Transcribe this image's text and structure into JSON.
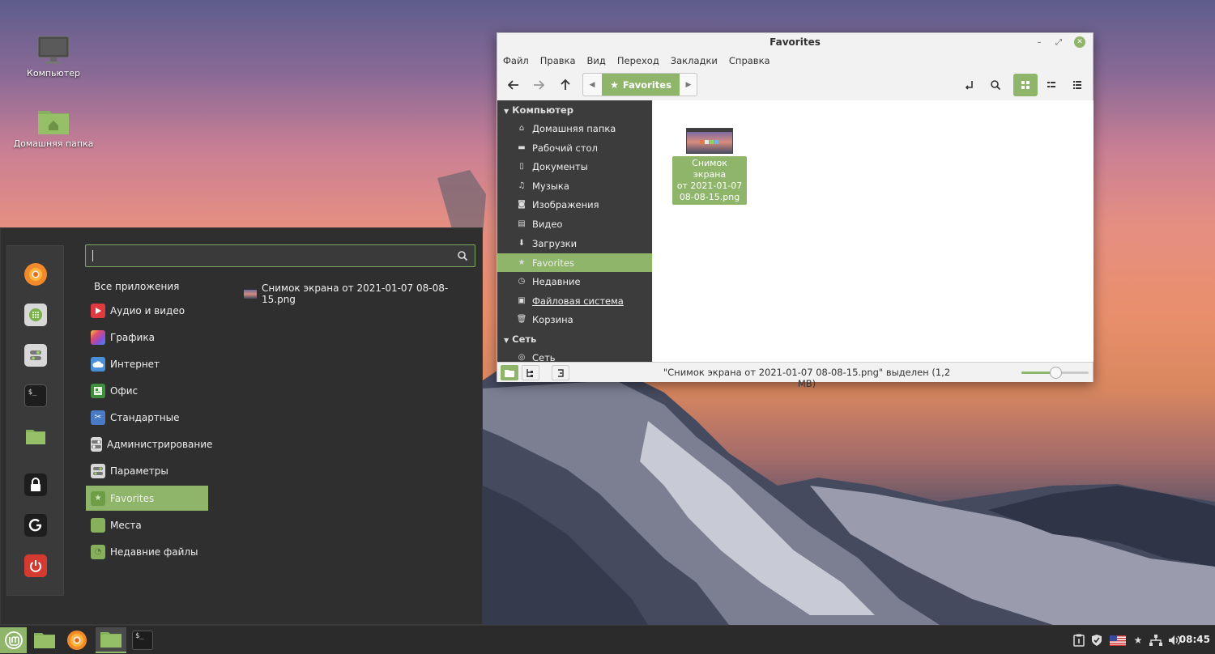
{
  "desktop": {
    "icons": [
      {
        "label": "Компьютер",
        "icon": "monitor-icon"
      },
      {
        "label": "Домашняя папка",
        "icon": "home-folder-icon"
      }
    ]
  },
  "menu": {
    "favorites": [
      "firefox-icon",
      "software-manager-icon",
      "settings-icon",
      "terminal-icon",
      "files-icon",
      "lock-icon",
      "logout-icon",
      "power-icon"
    ],
    "search": {
      "value": "",
      "placeholder": ""
    },
    "all_apps_label": "Все приложения",
    "categories": [
      {
        "label": "Аудио и видео",
        "icon": "multimedia-icon",
        "color": "#e0393e"
      },
      {
        "label": "Графика",
        "icon": "graphics-icon",
        "color": "#b84fd1"
      },
      {
        "label": "Интернет",
        "icon": "internet-icon",
        "color": "#4a90d9"
      },
      {
        "label": "Офис",
        "icon": "office-icon",
        "color": "#3f8f3f"
      },
      {
        "label": "Стандартные",
        "icon": "accessories-icon",
        "color": "#4a7cc6"
      },
      {
        "label": "Администрирование",
        "icon": "administration-icon",
        "color": "#8a8a8a"
      },
      {
        "label": "Параметры",
        "icon": "preferences-icon",
        "color": "#8a8a8a"
      },
      {
        "label": "Favorites",
        "icon": "favorites-folder-icon",
        "color": "#6d9e46"
      },
      {
        "label": "Места",
        "icon": "places-folder-icon",
        "color": "#86b05c"
      },
      {
        "label": "Недавние файлы",
        "icon": "recent-folder-icon",
        "color": "#86b05c"
      }
    ],
    "selected_category": "Favorites",
    "recent_file": "Снимок экрана от 2021-01-07 08-08-15.png"
  },
  "file_manager": {
    "title": "Favorites",
    "menubar": [
      "Файл",
      "Правка",
      "Вид",
      "Переход",
      "Закладки",
      "Справка"
    ],
    "location": "Favorites",
    "sidebar": {
      "computer_header": "Компьютер",
      "items": [
        {
          "label": "Домашняя папка",
          "icon": "home-icon"
        },
        {
          "label": "Рабочий стол",
          "icon": "desktop-icon"
        },
        {
          "label": "Документы",
          "icon": "documents-icon"
        },
        {
          "label": "Музыка",
          "icon": "music-icon"
        },
        {
          "label": "Изображения",
          "icon": "pictures-icon"
        },
        {
          "label": "Видео",
          "icon": "videos-icon"
        },
        {
          "label": "Загрузки",
          "icon": "downloads-icon"
        },
        {
          "label": "Favorites",
          "icon": "star-icon"
        },
        {
          "label": "Недавние",
          "icon": "recent-icon"
        },
        {
          "label": "Файловая система",
          "icon": "filesystem-icon"
        },
        {
          "label": "Корзина",
          "icon": "trash-icon"
        }
      ],
      "network_header": "Сеть",
      "network_items": [
        {
          "label": "Сеть",
          "icon": "network-icon"
        }
      ]
    },
    "file": {
      "name": "Снимок экрана от 2021-01-07 08-08-15.png",
      "name_lines": [
        "Снимок экрана",
        "от 2021-01-07",
        "08-08-15.png"
      ]
    },
    "status": "\"Снимок экрана от 2021-01-07 08-08-15.png\" выделен (1,2 MB)",
    "zoom_level": 0.5
  },
  "taskbar": {
    "clock": "08:45",
    "accent": "#8fb56a"
  }
}
